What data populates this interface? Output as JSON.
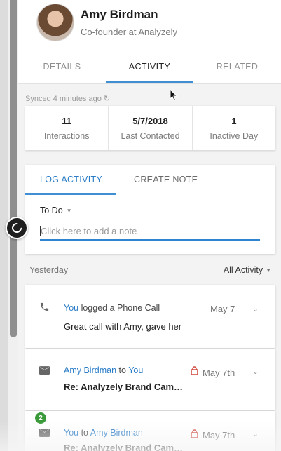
{
  "contact": {
    "name": "Amy Birdman",
    "role": "Co-founder at Analyzely"
  },
  "tabs": [
    "DETAILS",
    "ACTIVITY",
    "RELATED"
  ],
  "active_tab": "ACTIVITY",
  "synced_text": "Synced 4 minutes ago",
  "stats": [
    {
      "value": "11",
      "label": "Interactions"
    },
    {
      "value": "5/7/2018",
      "label": "Last Contacted"
    },
    {
      "value": "1",
      "label": "Inactive Day"
    }
  ],
  "log": {
    "tab_log": "LOG ACTIVITY",
    "tab_note": "CREATE NOTE",
    "todo_label": "To Do",
    "placeholder": "Click here to add a note"
  },
  "list": {
    "day_label": "Yesterday",
    "filter_label": "All Activity",
    "items": [
      {
        "actor": "You",
        "action": " logged a Phone Call",
        "date": "May 7",
        "text": "Great call with Amy, gave her"
      },
      {
        "from": "Amy Birdman",
        "mid": " to ",
        "to": "You",
        "date": "May 7th",
        "text": "Re: Analyzely Brand Cam…"
      },
      {
        "from": "You",
        "mid": " to ",
        "to": "Amy Birdman",
        "date": "May 7th",
        "text": "Re: Analyzely Brand Cam…",
        "badge": "2"
      }
    ]
  },
  "colors": {
    "accent": "#3f8fd2",
    "link": "#2a7cc7",
    "lock": "#d0453a",
    "badge": "#3a9a3a"
  }
}
